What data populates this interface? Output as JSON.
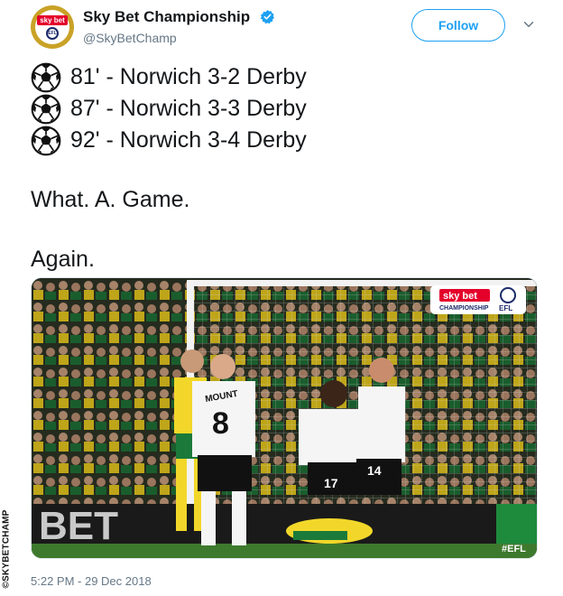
{
  "account": {
    "name": "Sky Bet Championship",
    "handle": "@SkyBetChamp",
    "avatar_text": "sky bet",
    "avatar_badge": "EFL",
    "verified": true
  },
  "actions": {
    "follow_label": "Follow",
    "menu_icon": "chevron-down-icon"
  },
  "tweet": {
    "lines": [
      {
        "icon": "soccer-ball-icon",
        "text": "81' - Norwich 3-2 Derby"
      },
      {
        "icon": "soccer-ball-icon",
        "text": "87' - Norwich 3-3 Derby"
      },
      {
        "icon": "soccer-ball-icon",
        "text": "92' - Norwich 3-4 Derby"
      }
    ],
    "paragraph_1": "What. A. Game.",
    "paragraph_2": "Again."
  },
  "media": {
    "logo_sky": "sky bet",
    "logo_sub": "CHAMPIONSHIP",
    "logo_efl": "EFL",
    "hashtag": "#EFL",
    "shirt_name": "MOUNT",
    "shirt_number": "8",
    "shirt_number_2": "14",
    "shirt_number_3": "17",
    "board_text": "BET"
  },
  "timestamp": "5:22 PM - 29 Dec 2018",
  "credit": "©SKYBETCHAMP",
  "colors": {
    "brand_blue": "#1da1f2",
    "text": "#14171a",
    "muted": "#657786",
    "sky_red": "#e4002b",
    "norwich_yellow": "#f2d72a",
    "norwich_green": "#1b7a3a"
  }
}
